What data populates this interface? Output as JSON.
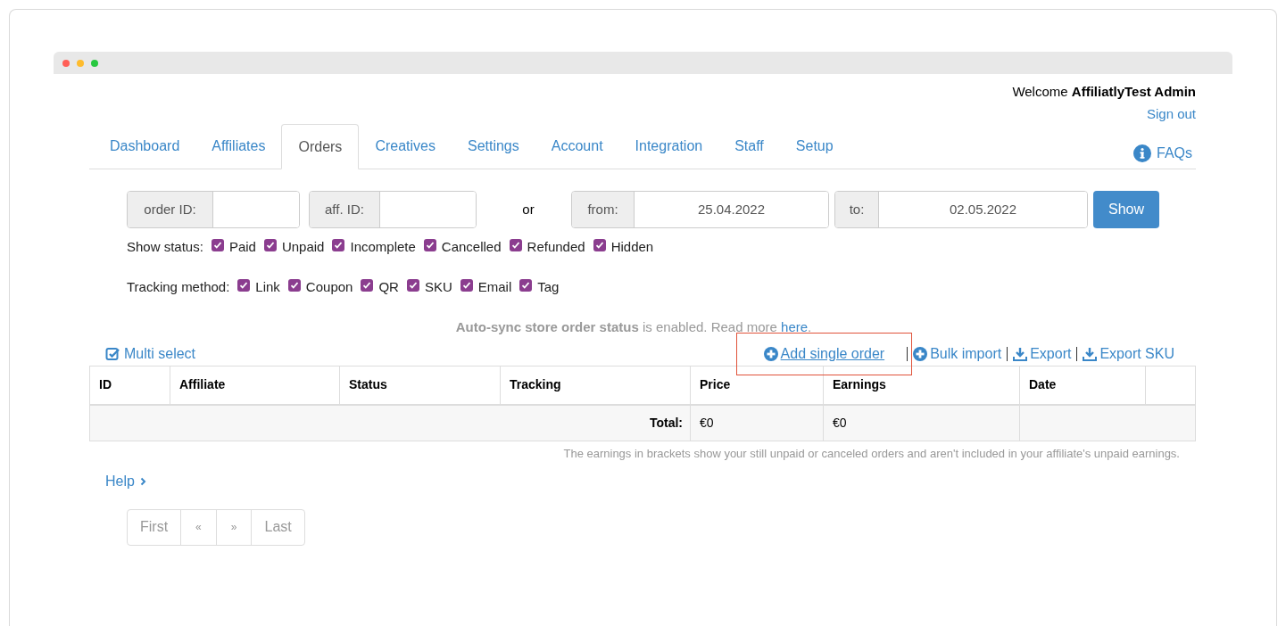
{
  "header": {
    "welcome": "Welcome **AffiliatlyTest Admin**",
    "sign_out": "Sign out"
  },
  "tabs": [
    {
      "label": "Dashboard",
      "selected": false
    },
    {
      "label": "Affiliates",
      "selected": false
    },
    {
      "label": "Orders",
      "selected": true
    },
    {
      "label": "Creatives",
      "selected": false
    },
    {
      "label": "Settings",
      "selected": false
    },
    {
      "label": "Account",
      "selected": false
    },
    {
      "label": "Integration",
      "selected": false
    },
    {
      "label": "Staff",
      "selected": false
    },
    {
      "label": "Setup",
      "selected": false
    }
  ],
  "faqs": "FAQs",
  "filters": {
    "order_id": {
      "label": "order ID:"
    },
    "aff_id": {
      "label": "aff. ID:"
    },
    "or": "or",
    "from": {
      "label": "from:",
      "value": "25.04.2022"
    },
    "to": {
      "label": "to:",
      "value": "02.05.2022"
    },
    "button": "Show"
  },
  "status_filter": {
    "label": "Show status:",
    "options": [
      {
        "label": "Paid",
        "checked": true
      },
      {
        "label": "Unpaid",
        "checked": true
      },
      {
        "label": "Incomplete",
        "checked": true
      },
      {
        "label": "Cancelled",
        "checked": true
      },
      {
        "label": "Refunded",
        "checked": true
      },
      {
        "label": "Hidden",
        "checked": true
      }
    ]
  },
  "tracking_filter": {
    "label": "Tracking method:",
    "options": [
      {
        "label": "Link",
        "checked": true
      },
      {
        "label": "Coupon",
        "checked": true
      },
      {
        "label": "QR",
        "checked": true
      },
      {
        "label": "SKU",
        "checked": true
      },
      {
        "label": "Email",
        "checked": true
      },
      {
        "label": "Tag",
        "checked": true
      }
    ]
  },
  "notice": {
    "text": "**Auto-sync store order status** is enabled. Read more ",
    "link": "here",
    "end": "."
  },
  "multi_select": "Multi select",
  "actions": [
    {
      "label": "Add single order",
      "kind": "add",
      "highlighted": true
    },
    {
      "label": "Bulk import",
      "kind": "add",
      "highlighted": false
    },
    {
      "label": "Export",
      "kind": "download",
      "highlighted": false
    },
    {
      "label": "Export SKU",
      "kind": "download",
      "highlighted": false
    }
  ],
  "table": {
    "columns": [
      "ID",
      "Affiliate",
      "Status",
      "Tracking",
      "Price",
      "Earnings",
      "Date"
    ],
    "total": {
      "label": "Total:",
      "price": "€0",
      "earnings": "€0"
    }
  },
  "footnote": "The earnings in brackets show your still unpaid or canceled orders and aren't included in your affiliate's unpaid earnings.",
  "help": "Help",
  "pagination": [
    "First",
    "«",
    "»",
    "Last"
  ]
}
